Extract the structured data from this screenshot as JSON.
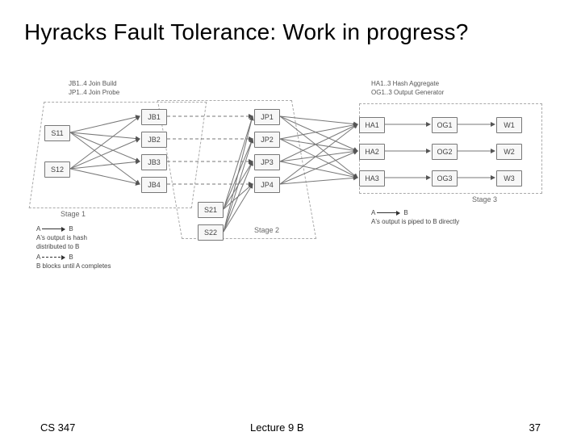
{
  "title": "Hyracks Fault Tolerance: Work in progress?",
  "footer": {
    "left": "CS 347",
    "mid": "Lecture 9 B",
    "right": "37"
  },
  "topLabels": {
    "left": "JB1..4 Join Build\nJP1..4 Join Probe",
    "right": "HA1..3 Hash Aggregate\nOG1..3 Output Generator"
  },
  "stages": {
    "s1": "Stage 1",
    "s2": "Stage 2",
    "s3": "Stage 3"
  },
  "legendLeft": {
    "l1a": "A",
    "l1b": "B",
    "l1text": "A's output is hash",
    "l1text2": "distributed to B",
    "l2a": "A",
    "l2b": "B",
    "l2text": "B blocks until A completes"
  },
  "legendRight": {
    "r1a": "A",
    "r1b": "B",
    "r1text": "A's output is piped to B directly"
  },
  "nodes": {
    "S11": "S11",
    "S12": "S12",
    "JB1": "JB1",
    "JB2": "JB2",
    "JB3": "JB3",
    "JB4": "JB4",
    "JP1": "JP1",
    "JP2": "JP2",
    "JP3": "JP3",
    "JP4": "JP4",
    "S21": "S21",
    "S22": "S22",
    "HA1": "HA1",
    "HA2": "HA2",
    "HA3": "HA3",
    "OG1": "OG1",
    "OG2": "OG2",
    "OG3": "OG3",
    "W1": "W1",
    "W2": "W2",
    "W3": "W3"
  },
  "chart_data": {
    "type": "diagram",
    "nodes": [
      {
        "id": "S11",
        "group": "scan1"
      },
      {
        "id": "S12",
        "group": "scan1"
      },
      {
        "id": "JB1",
        "group": "joinBuild"
      },
      {
        "id": "JB2",
        "group": "joinBuild"
      },
      {
        "id": "JB3",
        "group": "joinBuild"
      },
      {
        "id": "JB4",
        "group": "joinBuild"
      },
      {
        "id": "JP1",
        "group": "joinProbe"
      },
      {
        "id": "JP2",
        "group": "joinProbe"
      },
      {
        "id": "JP3",
        "group": "joinProbe"
      },
      {
        "id": "JP4",
        "group": "joinProbe"
      },
      {
        "id": "S21",
        "group": "scan2"
      },
      {
        "id": "S22",
        "group": "scan2"
      },
      {
        "id": "HA1",
        "group": "hashAgg"
      },
      {
        "id": "HA2",
        "group": "hashAgg"
      },
      {
        "id": "HA3",
        "group": "hashAgg"
      },
      {
        "id": "OG1",
        "group": "outGen"
      },
      {
        "id": "OG2",
        "group": "outGen"
      },
      {
        "id": "OG3",
        "group": "outGen"
      },
      {
        "id": "W1",
        "group": "writer"
      },
      {
        "id": "W2",
        "group": "writer"
      },
      {
        "id": "W3",
        "group": "writer"
      }
    ],
    "edges_hash_distributed": [
      [
        "S11",
        "JB1"
      ],
      [
        "S11",
        "JB2"
      ],
      [
        "S11",
        "JB3"
      ],
      [
        "S11",
        "JB4"
      ],
      [
        "S12",
        "JB1"
      ],
      [
        "S12",
        "JB2"
      ],
      [
        "S12",
        "JB3"
      ],
      [
        "S12",
        "JB4"
      ],
      [
        "S21",
        "JP1"
      ],
      [
        "S21",
        "JP2"
      ],
      [
        "S21",
        "JP3"
      ],
      [
        "S21",
        "JP4"
      ],
      [
        "S22",
        "JP1"
      ],
      [
        "S22",
        "JP2"
      ],
      [
        "S22",
        "JP3"
      ],
      [
        "S22",
        "JP4"
      ],
      [
        "JP1",
        "HA1"
      ],
      [
        "JP1",
        "HA2"
      ],
      [
        "JP1",
        "HA3"
      ],
      [
        "JP2",
        "HA1"
      ],
      [
        "JP2",
        "HA2"
      ],
      [
        "JP2",
        "HA3"
      ],
      [
        "JP3",
        "HA1"
      ],
      [
        "JP3",
        "HA2"
      ],
      [
        "JP3",
        "HA3"
      ],
      [
        "JP4",
        "HA1"
      ],
      [
        "JP4",
        "HA2"
      ],
      [
        "JP4",
        "HA3"
      ]
    ],
    "edges_blocking_dashed": [
      [
        "JB1",
        "JP1"
      ],
      [
        "JB2",
        "JP2"
      ],
      [
        "JB3",
        "JP3"
      ],
      [
        "JB4",
        "JP4"
      ]
    ],
    "edges_piped": [
      [
        "HA1",
        "OG1"
      ],
      [
        "HA2",
        "OG2"
      ],
      [
        "HA3",
        "OG3"
      ],
      [
        "OG1",
        "W1"
      ],
      [
        "OG2",
        "W2"
      ],
      [
        "OG3",
        "W3"
      ]
    ],
    "stage_boundaries": {
      "Stage 1": [
        "S11",
        "S12",
        "JB1",
        "JB2",
        "JB3",
        "JB4"
      ],
      "Stage 2": [
        "JP1",
        "JP2",
        "JP3",
        "JP4",
        "S21",
        "S22"
      ],
      "Stage 3": [
        "HA1",
        "HA2",
        "HA3",
        "OG1",
        "OG2",
        "OG3",
        "W1",
        "W2",
        "W3"
      ]
    }
  }
}
